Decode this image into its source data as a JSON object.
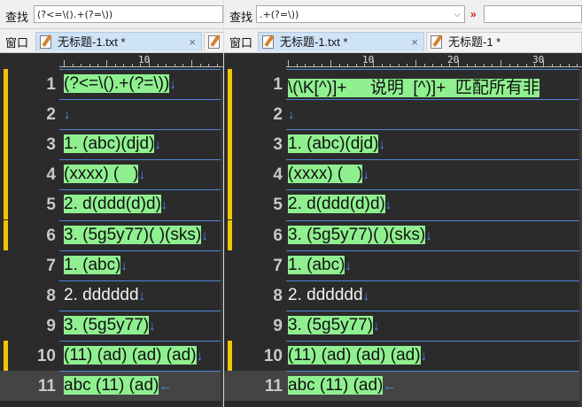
{
  "left": {
    "search": {
      "label": "查找",
      "value": "(?<=\\().+(?=\\))"
    },
    "tabs": {
      "label": "窗口",
      "active": "无标题-1.txt *",
      "close": "×"
    },
    "ruler_numbers": [
      "10"
    ],
    "lines": [
      {
        "n": "1",
        "text": "(?<=\\().+(?=\\))",
        "hl": true,
        "mark": true,
        "lf": "↓"
      },
      {
        "n": "2",
        "text": "",
        "hl": false,
        "mark": true,
        "lf": "↓"
      },
      {
        "n": "3",
        "text": "1. (abc)(djd)",
        "hl": true,
        "mark": true,
        "lf": "↓"
      },
      {
        "n": "4",
        "text": "(xxxx) (   )",
        "hl": true,
        "mark": true,
        "lf": "↓"
      },
      {
        "n": "5",
        "text": "2. d(ddd(d)d)",
        "hl": true,
        "mark": true,
        "lf": "↓"
      },
      {
        "n": "6",
        "text": "3. (5g5y77)( )(sks)",
        "hl": true,
        "mark": true,
        "lf": "↓"
      },
      {
        "n": "7",
        "text": "1. (abc)",
        "hl": true,
        "mark": false,
        "lf": "↓"
      },
      {
        "n": "8",
        "text": "2. dddddd",
        "hl": false,
        "mark": false,
        "lf": "↓"
      },
      {
        "n": "9",
        "text": "3. (5g5y77)",
        "hl": true,
        "mark": false,
        "lf": "↓"
      },
      {
        "n": "10",
        "text": "(11) (ad) (ad) (ad)",
        "hl": true,
        "mark": true,
        "lf": "↓"
      },
      {
        "n": "11",
        "text": "abc (11) (ad)",
        "hl": true,
        "mark": false,
        "lf": "←"
      }
    ]
  },
  "right": {
    "search": {
      "label": "查找",
      "value": ".+(?=\\))",
      "next": "»"
    },
    "tabs": {
      "label": "窗口",
      "active": "无标题-1.txt *",
      "close": "×",
      "second": "无标题-1 *"
    },
    "ruler_numbers": [
      "10",
      "20",
      "30"
    ],
    "lines": [
      {
        "n": "1",
        "text": "\\(\\K[^)]+     说明  [^)]+  匹配所有非",
        "hl": true,
        "mark": true,
        "lf": ""
      },
      {
        "n": "2",
        "text": "",
        "hl": false,
        "mark": true,
        "lf": "↓"
      },
      {
        "n": "3",
        "text": "1. (abc)(djd)",
        "hl": true,
        "mark": true,
        "lf": "↓"
      },
      {
        "n": "4",
        "text": "(xxxx) (   )",
        "hl": true,
        "mark": true,
        "lf": "↓"
      },
      {
        "n": "5",
        "text": "2. d(ddd(d)d)",
        "hl": true,
        "mark": true,
        "lf": "↓"
      },
      {
        "n": "6",
        "text": "3. (5g5y77)( )(sks)",
        "hl": true,
        "mark": true,
        "lf": "↓"
      },
      {
        "n": "7",
        "text": "1. (abc)",
        "hl": true,
        "mark": false,
        "lf": "↓"
      },
      {
        "n": "8",
        "text": "2. dddddd",
        "hl": false,
        "mark": false,
        "lf": "↓"
      },
      {
        "n": "9",
        "text": "3. (5g5y77)",
        "hl": true,
        "mark": false,
        "lf": "↓"
      },
      {
        "n": "10",
        "text": "(11) (ad) (ad) (ad)",
        "hl": true,
        "mark": true,
        "lf": "↓"
      },
      {
        "n": "11",
        "text": "abc (11) (ad)",
        "hl": true,
        "mark": false,
        "lf": "←"
      }
    ]
  }
}
